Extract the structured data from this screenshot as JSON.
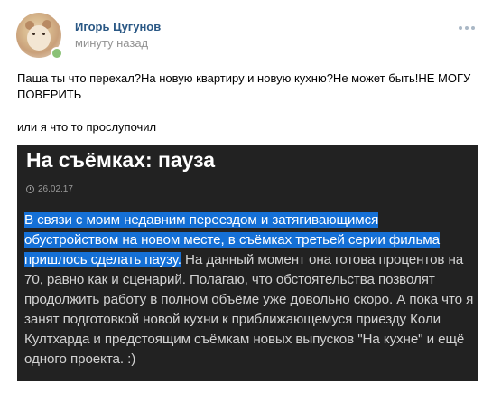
{
  "post": {
    "author": "Игорь Цугунов",
    "time": "минуту назад",
    "text_line1": "Паша ты что перехал?На новую квартиру и новую кухню?Не может быть!НЕ МОГУ ПОВЕРИТЬ",
    "text_line2": "или я что то прослупочил"
  },
  "attachment": {
    "title": "На съёмках: пауза",
    "date": "26.02.17",
    "highlighted_text": "В связи с моим недавним переездом и затягивающимся обустройством на новом месте, в съёмках третьей серии фильма пришлось сделать паузу.",
    "body_text": " На данный момент она готова процентов на 70, равно как и сценарий. Полагаю, что обстоятельства позволят продолжить работу в полном объёме уже довольно скоро. А пока что я занят подготовкой новой кухни к приближающемуся приезду Коли Култхарда и предстоящим съёмкам новых выпусков \"На кухне\" и ещё одного проекта. :)"
  },
  "colors": {
    "author_link": "#2a5885",
    "muted": "#939393",
    "online": "#8ac176",
    "highlight": "#1570d6",
    "image_bg": "#222222"
  },
  "icons": {
    "avatar": "hamster-avatar",
    "more": "more-dots-icon",
    "clock": "clock-icon"
  }
}
